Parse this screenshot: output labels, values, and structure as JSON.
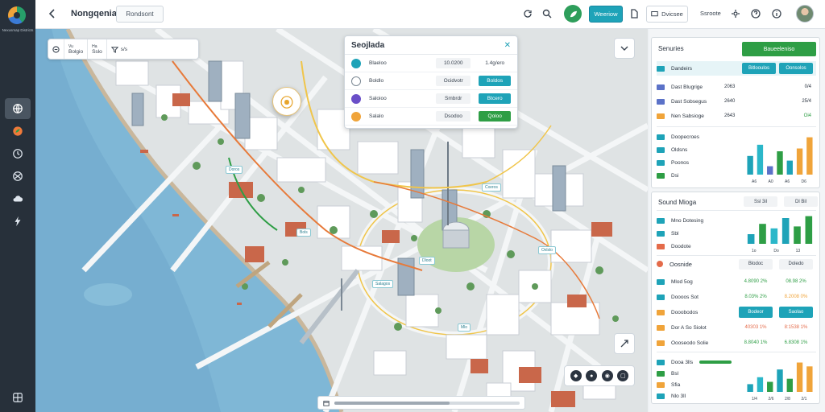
{
  "app": {
    "brand": "Nexusmap\nDistricts",
    "title": "Nongqenia",
    "title_chip": "Rondsont"
  },
  "topbar": {
    "btn_teal": "Weeriow",
    "btn_outline": "Dvicsee",
    "text_right": "Ssroote",
    "icons": [
      "refresh-icon",
      "search-icon",
      "leaf-icon",
      "file-icon",
      "settings-icon",
      "help-icon",
      "info-icon"
    ]
  },
  "map_toolbar": {
    "items": [
      {
        "icon": "minus-circle-icon",
        "label": ""
      },
      {
        "icon": "route-icon",
        "top": "Vu",
        "label": "Bolgio"
      },
      {
        "icon": "layers-icon",
        "top": "Ha",
        "label": "Sslo"
      },
      {
        "icon": "filter-icon",
        "top": "",
        "label": "s/s"
      }
    ]
  },
  "location_card": {
    "title": "Seojlada",
    "close": "✕",
    "rows": [
      {
        "name": "Blaeloo",
        "value": "10.0200",
        "status": "1.4g/ero",
        "color": "#1ea3b8",
        "status_style": "text"
      },
      {
        "name": "Boldlo",
        "value": "Ocidvotr",
        "status": "Boldos",
        "color": "#ffffff",
        "status_style": "teal"
      },
      {
        "name": "Saloioo",
        "value": "Smbrdr",
        "status": "Btcero",
        "color": "#6a4fc8",
        "status_style": "teal"
      },
      {
        "name": "Salalo",
        "value": "Dsodoo",
        "status": "Qoloo",
        "color": "#f0a43a",
        "status_style": "green"
      }
    ]
  },
  "map_labels": [
    "Doros",
    "Cxeros",
    "Bols",
    "Oxlslo",
    "Dloot",
    "Salagos",
    "Mlo"
  ],
  "right_panel": {
    "card1": {
      "title": "Senuries",
      "button": "Baueeleniso",
      "header": {
        "label": "Dandeirs",
        "a": "Bitlooulos",
        "b": "Oonsolos"
      },
      "rows": [
        {
          "label": "Dast Blugrige",
          "num": "2063",
          "right": "0/4",
          "color": "#5b72c8"
        },
        {
          "label": "Dast Sobsegus",
          "num": "2640",
          "right": "25/4",
          "color": "#5b72c8"
        },
        {
          "label": "Nen Sabsioge",
          "num": "2643",
          "right": "Oi4",
          "color": "#f0a43a"
        }
      ],
      "legend": [
        {
          "label": "Doopecroes",
          "color": "#1ea3b8"
        },
        {
          "label": "Oldsns",
          "color": "#1ea3b8"
        },
        {
          "label": "Poonos",
          "color": "#1ea3b8"
        },
        {
          "label": "Dsi",
          "color": "#2e9e45"
        }
      ],
      "chart_labels": [
        "A6",
        "A0",
        "A6",
        "D6"
      ],
      "bars": [
        {
          "value": 40,
          "color": "#1ea3b8"
        },
        {
          "value": 64,
          "color": "#2bb7c9"
        },
        {
          "value": 18,
          "color": "#5b72c8"
        },
        {
          "value": 50,
          "color": "#2e9e45"
        },
        {
          "value": 30,
          "color": "#1ea3b8"
        },
        {
          "value": 56,
          "color": "#f0a43a"
        },
        {
          "value": 80,
          "color": "#f0a43a"
        }
      ]
    },
    "card2": {
      "title": "Sound Mioga",
      "stat_a": "Ssl 3il",
      "stat_b": "Dl Bil",
      "rows_top": [
        {
          "label": "Mno Dotesing",
          "color": "#1ea3b8"
        },
        {
          "label": "Sbl",
          "color": "#1ea3b8"
        },
        {
          "label": "Doodote",
          "color": "#e46b4a"
        }
      ],
      "chart_labels": [
        "1o",
        "Do",
        "13"
      ],
      "bars": [
        {
          "value": 30,
          "color": "#1ea3b8"
        },
        {
          "value": 62,
          "color": "#2e9e45"
        },
        {
          "value": 48,
          "color": "#2bb7c9"
        },
        {
          "value": 80,
          "color": "#1ea3b8"
        },
        {
          "value": 54,
          "color": "#2e9e45"
        },
        {
          "value": 86,
          "color": "#2e9e45"
        }
      ],
      "section": {
        "label": "Oosnide",
        "a": "Blodoc",
        "b": "Doledo"
      },
      "stats": [
        {
          "label": "Mlod 5og",
          "a": "4.8090 2%",
          "b": "08.98 2%",
          "a_color": "#2e9e45",
          "b_color": "#2e9e45",
          "sw": "#1ea3b8"
        },
        {
          "label": "Doooos Sot",
          "a": "8.03% 2%",
          "b": "8.2008 0%",
          "b_color": "#f0a43a",
          "a_color": "#2e9e45",
          "sw": "#1ea3b8"
        },
        {
          "label": "Dooobodos",
          "a": "Bodeor",
          "b": "Saolao",
          "a_color": "#ffffff",
          "b_color": "#ffffff",
          "sw": "#f0a43a",
          "teal": true
        },
        {
          "label": "Dor A So Siolot",
          "a": "40303 1%",
          "b": "8:1538 1%",
          "a_color": "#e46b4a",
          "b_color": "#e46b4a",
          "sw": "#f0a43a"
        },
        {
          "label": "Oooseodo Solie",
          "a": "8.8040 1%",
          "b": "6.8308 1%",
          "a_color": "#2e9e45",
          "b_color": "#2e9e45",
          "sw": "#f0a43a"
        }
      ],
      "bottom_rows": [
        {
          "label": "Dooa 3lls",
          "color": "#1ea3b8"
        },
        {
          "label": "Bsl",
          "color": "#2e9e45"
        },
        {
          "label": "Sfia",
          "color": "#f0a43a"
        },
        {
          "label": "Nlo 3ll",
          "color": "#1ea3b8"
        }
      ],
      "bottom_chart_labels": [
        "1/4",
        "2/6",
        "2/8",
        "2/1"
      ],
      "bottom_bars": [
        {
          "value": 20,
          "color": "#1ea3b8"
        },
        {
          "value": 38,
          "color": "#2bb7c9"
        },
        {
          "value": 26,
          "color": "#2e9e45"
        },
        {
          "value": 58,
          "color": "#1ea3b8"
        },
        {
          "value": 34,
          "color": "#2e9e45"
        },
        {
          "value": 76,
          "color": "#f0a43a"
        },
        {
          "value": 66,
          "color": "#f0a43a"
        }
      ]
    }
  }
}
